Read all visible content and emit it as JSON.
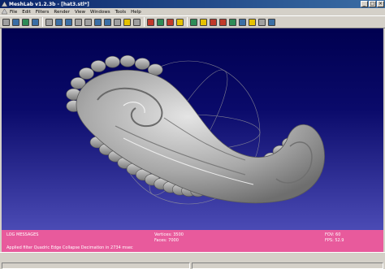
{
  "window": {
    "title": "MeshLab v1.2.3b - [hat3.stl*]",
    "minimize_glyph": "_",
    "maximize_glyph": "□",
    "close_glyph": "×"
  },
  "menu": {
    "items": [
      "File",
      "Edit",
      "Filters",
      "Render",
      "View",
      "Windows",
      "Tools",
      "Help"
    ]
  },
  "toolbar": {
    "icons": [
      "open-icon",
      "save-icon",
      "reload-icon",
      "snapshot-icon",
      "layers-icon",
      "points-icon",
      "wireframe-icon",
      "hidden-lines-icon",
      "flat-lines-icon",
      "flat-icon",
      "smooth-icon",
      "texture-icon",
      "light-icon",
      "backface-icon",
      "select-icon",
      "measure-icon",
      "color-paint-icon",
      "align-icon",
      "pick-points-icon",
      "info-icon",
      "annotate-icon",
      "paint-icon",
      "rotate-icon",
      "slice-icon",
      "shader-icon",
      "tools-icon",
      "help-icon"
    ],
    "icon_colors": {
      "primary": "#3a6ea5",
      "green": "#2e8b57",
      "red": "#c0392b",
      "yellow": "#e6c200",
      "gray": "#a0a0a0"
    }
  },
  "viewport": {
    "background_top": "#000050",
    "background_bottom": "#4b4bb5",
    "mesh_color": "#b8b8b8",
    "trackball_color": "#9a9a9a"
  },
  "log": {
    "header": "LOG MESSAGES",
    "message": "Applied filter Quadric Edge Collapse Decimation in 2734 msec",
    "vertices_label": "Vertices: 3500",
    "faces_label": "Faces: 7000",
    "fov_label": "FOV: 60",
    "fps_label": "FPS:  52.9",
    "background": "#e85a9c"
  }
}
